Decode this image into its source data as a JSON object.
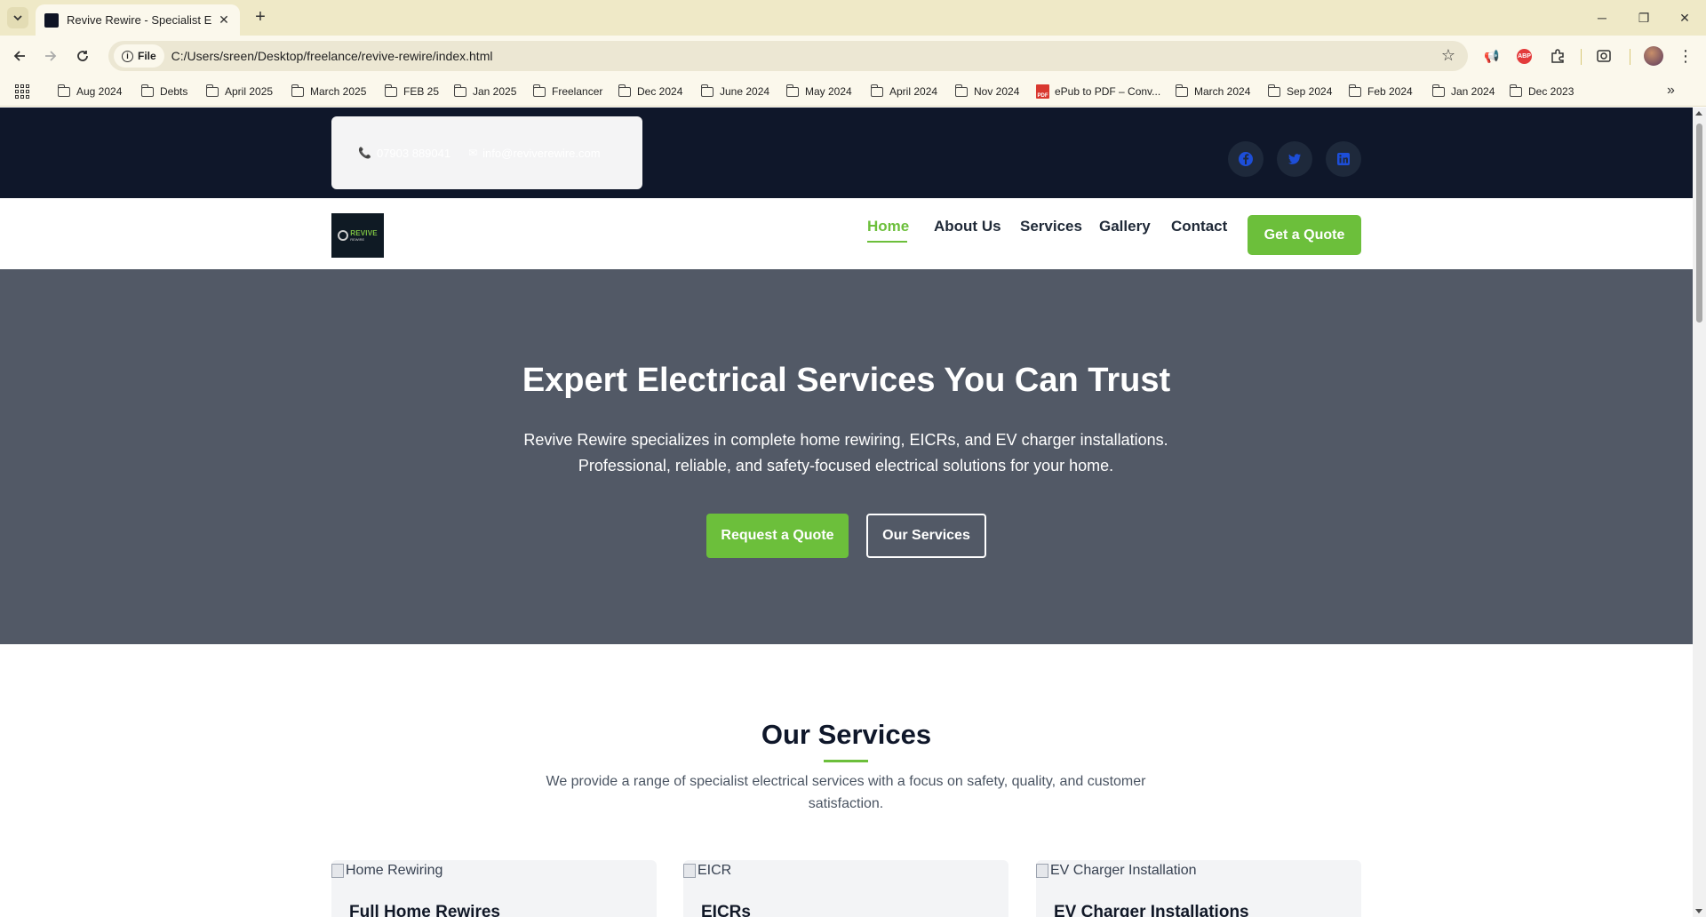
{
  "browser": {
    "tab_title": "Revive Rewire - Specialist Electr",
    "url_chip": "File",
    "url": "C:/Users/sreen/Desktop/freelance/revive-rewire/index.html",
    "bookmarks": [
      "Aug 2024",
      "Debts",
      "April 2025",
      "March 2025",
      "FEB 25",
      "Jan 2025",
      "Freelancer",
      "Dec 2024",
      "June 2024",
      "May 2024",
      "April 2024",
      "Nov 2024",
      "ePub to PDF – Conv...",
      "March 2024",
      "Sep 2024",
      "Feb 2024",
      "Jan 2024",
      "Dec 2023"
    ]
  },
  "site": {
    "topbar": {
      "phone": "07903 889041",
      "email": "info@reviverewire.com",
      "social": [
        "facebook",
        "twitter",
        "linkedin"
      ]
    },
    "logo": {
      "text": "REVIVE",
      "sub": "REWIRE"
    },
    "nav": {
      "links": [
        "Home",
        "About Us",
        "Services",
        "Gallery",
        "Contact"
      ],
      "active": "Home",
      "cta": "Get a Quote"
    },
    "hero": {
      "title": "Expert Electrical Services You Can Trust",
      "line1": "Revive Rewire specializes in complete home rewiring, EICRs, and EV charger installations.",
      "line2": "Professional, reliable, and safety-focused electrical solutions for your home.",
      "primary_btn": "Request a Quote",
      "secondary_btn": "Our Services"
    },
    "services": {
      "title": "Our Services",
      "desc_line1": "We provide a range of specialist electrical services with a focus on safety, quality, and customer",
      "desc_line2": "satisfaction.",
      "cards": [
        {
          "img_alt": "Home Rewiring",
          "title": "Full Home Rewires"
        },
        {
          "img_alt": "EICR",
          "title": "EICRs"
        },
        {
          "img_alt": "EV Charger Installation",
          "title": "EV Charger Installations"
        }
      ]
    }
  },
  "colors": {
    "accent_green": "#6cbf3b",
    "topbar_navy": "#0f172a",
    "hero_gray": "#525966"
  }
}
